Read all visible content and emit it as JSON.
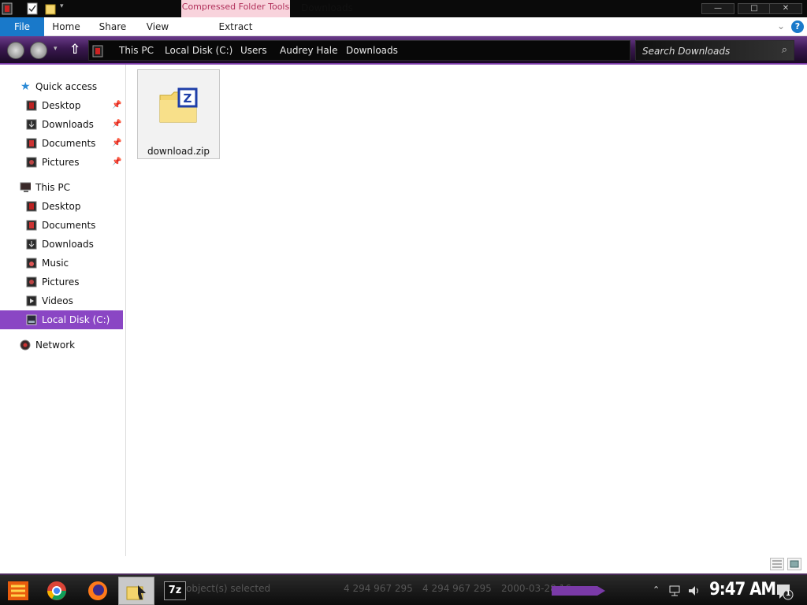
{
  "window": {
    "title": "Downloads",
    "contextual_tab": "Compressed Folder Tools",
    "controls": {
      "minimize": "—",
      "maximize": "□",
      "close": "✕"
    }
  },
  "ribbon": {
    "tabs": [
      {
        "label": "File",
        "active": true
      },
      {
        "label": "Home"
      },
      {
        "label": "Share"
      },
      {
        "label": "View"
      },
      {
        "label": "Extract"
      }
    ]
  },
  "address": {
    "breadcrumbs": [
      "This PC",
      "Local Disk (C:)",
      "Users",
      "Audrey Hale",
      "Downloads"
    ],
    "search_placeholder": "Search Downloads"
  },
  "sidebar": {
    "items": [
      {
        "label": "Quick access",
        "icon": "star-icon",
        "level": 0
      },
      {
        "label": "Desktop",
        "icon": "desktop-icon",
        "level": 1,
        "pinned": true
      },
      {
        "label": "Downloads",
        "icon": "downloads-icon",
        "level": 1,
        "pinned": true
      },
      {
        "label": "Documents",
        "icon": "documents-icon",
        "level": 1,
        "pinned": true
      },
      {
        "label": "Pictures",
        "icon": "pictures-icon",
        "level": 1,
        "pinned": true
      },
      {
        "label": "This PC",
        "icon": "computer-icon",
        "level": 0
      },
      {
        "label": "Desktop",
        "icon": "desktop-icon",
        "level": 1
      },
      {
        "label": "Documents",
        "icon": "documents-icon",
        "level": 1
      },
      {
        "label": "Downloads",
        "icon": "downloads-icon",
        "level": 1
      },
      {
        "label": "Music",
        "icon": "music-icon",
        "level": 1
      },
      {
        "label": "Pictures",
        "icon": "pictures-icon",
        "level": 1
      },
      {
        "label": "Videos",
        "icon": "videos-icon",
        "level": 1
      },
      {
        "label": "Local Disk (C:)",
        "icon": "drive-icon",
        "level": 1,
        "selected": true
      },
      {
        "label": "Network",
        "icon": "network-icon",
        "level": 0
      }
    ],
    "pin_glyph": "📌"
  },
  "files": [
    {
      "name": "download.zip",
      "icon": "zip-folder-icon"
    }
  ],
  "taskbar": {
    "status_text": "object(s) selected",
    "values": [
      "4 294 967 295",
      "4 294 967 295",
      "2000-03-28 16"
    ],
    "clock": "9:47 AM",
    "notification_count": "1",
    "sevenzip_label": "7z"
  },
  "colors": {
    "accent": "#8a46c4",
    "file_tab": "#1979ca",
    "context_tab": "#f8d3dc"
  }
}
